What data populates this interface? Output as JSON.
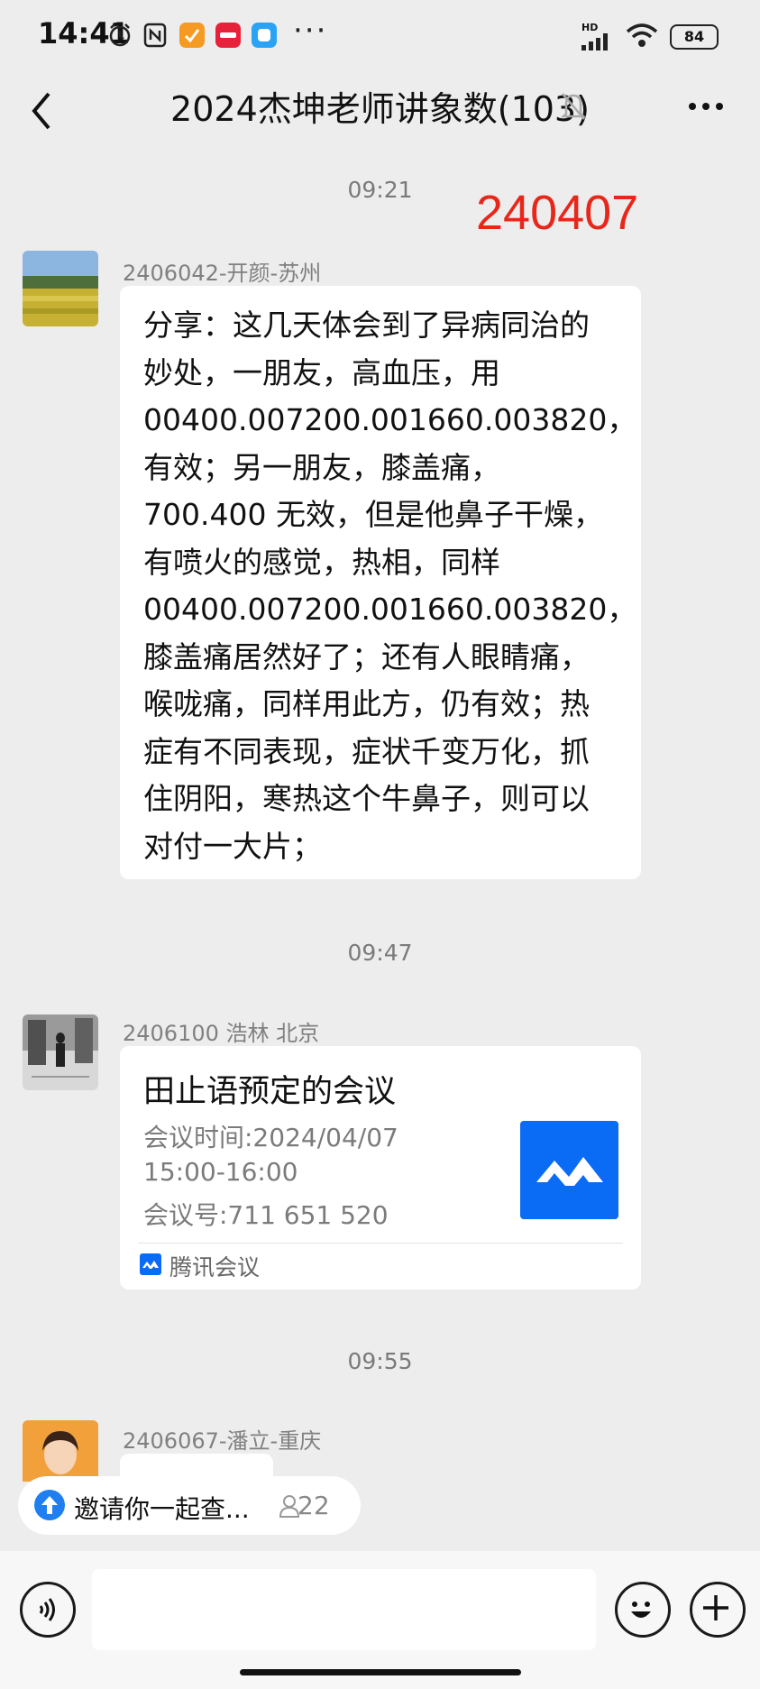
{
  "status_bar": {
    "time": "14:41",
    "icons": [
      "alarm-icon",
      "nfc-icon",
      "app-orange-icon",
      "xiaohongshu-icon",
      "app-blue-icon"
    ],
    "more": "···",
    "network": "HD",
    "battery": "84"
  },
  "header": {
    "back_icon": "chevron-left-icon",
    "title": "2024杰坤老师讲象数(103)",
    "mute_icon": "bell-off-icon",
    "more_icon": "more-icon"
  },
  "messages": {
    "time_1": "09:21",
    "stamp": "240407",
    "msg1": {
      "sender": "2406042-开颜-苏州",
      "text": "分享：这几天体会到了异病同治的\n妙处，一朋友，高血压，用\n00400.007200.001660.003820，\n有效；另一朋友，膝盖痛，\n700.400 无效，但是他鼻子干燥，\n有喷火的感觉，热相，同样\n00400.007200.001660.003820，\n膝盖痛居然好了；还有人眼睛痛，\n喉咙痛，同样用此方，仍有效；热\n症有不同表现，症状千变万化，抓\n住阴阳，寒热这个牛鼻子，则可以\n对付一大片；"
    },
    "time_2": "09:47",
    "msg2": {
      "sender": "2406100 浩林 北京",
      "title": "田止语预定的会议",
      "time_line": "会议时间:2024/04/07",
      "range": "15:00-16:00",
      "id_line": "会议号:711 651 520",
      "app_name": "腾讯会议"
    },
    "time_3": "09:55",
    "msg3": {
      "sender": "2406067-潘立-重庆"
    }
  },
  "invite": {
    "text": "邀请你一起查...",
    "count": "22"
  },
  "input_bar": {
    "placeholder": "",
    "voice_icon": "voice-icon",
    "emoji_icon": "emoji-icon",
    "add_icon": "plus-icon"
  }
}
